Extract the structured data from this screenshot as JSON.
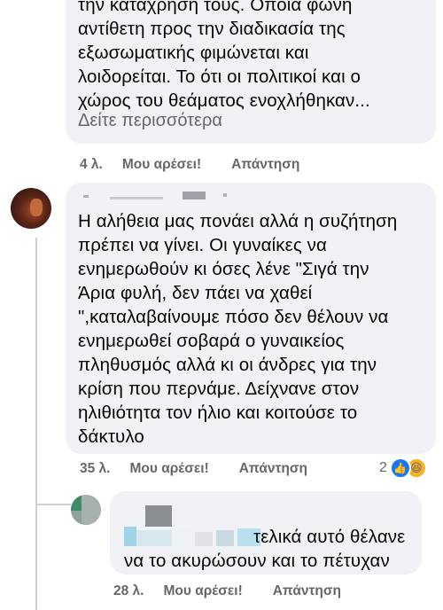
{
  "comments": [
    {
      "text": "την καταχρηση τους. Οποία φωνή\nαντίθετη προς την διαδικασία της\nεξωσωματικής φιμώνεται και\nλοιδορείται. Το ότι οι πολιτικοί και ο\nχώρος του θεάματος ενοχλήθηκαν...",
      "see_more": "Δείτε περισσότερα",
      "time": "4 λ.",
      "like": "Μου αρέσει!",
      "reply": "Απάντηση"
    },
    {
      "text": "Η αλήθεια μας πονάει αλλά η συζήτηση\nπρέπει να γίνει. Οι γυναίκες να\nενημερωθούν κι όσες λένε \"Σιγά την\nΆρια φυλή, δεν πάει να χαθεί\n\",καταλαβαίνουμε πόσο δεν θέλουν να\nενημερωθεί σοβαρά ο γυναικείος\nπληθυσμός αλλά κι οι άνδρες για την\nκρίση που περνάμε. Δείχνανε στον\nηλιθιότητα τον ήλιο και κοιτούσε το\nδάκτυλο",
      "time": "35 λ.",
      "like": "Μου αρέσει!",
      "reply": "Απάντηση",
      "reaction_count": "2",
      "reactions": [
        "like-icon",
        "haha-icon"
      ]
    },
    {
      "text_line1": "τελικά αυτό θέλανε",
      "text_line2": "να το ακυρώσουν και το πέτυχαν",
      "time": "28 λ.",
      "like": "Μου αρέσει!",
      "reply": "Απάντηση"
    }
  ],
  "colors": {
    "bubble": "#f0f2f5",
    "meta": "#65676b",
    "like_blue": "#1877f2",
    "haha_yellow": "#f7b125"
  }
}
